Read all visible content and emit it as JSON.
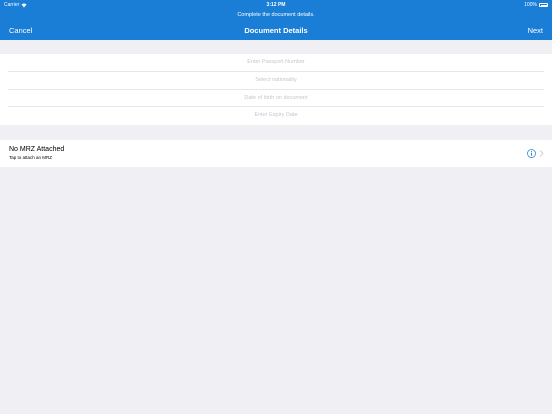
{
  "status_bar": {
    "carrier": "Carrier",
    "time": "3:12 PM",
    "battery_percent": "100%",
    "battery_level": 1.0
  },
  "header": {
    "prompt": "Complete the document details.",
    "cancel_label": "Cancel",
    "title": "Document Details",
    "next_label": "Next"
  },
  "form": {
    "passport_number_placeholder": "Enter Passport Number",
    "nationality_placeholder": "Select nationality",
    "dob_placeholder": "Date of birth on document",
    "expiry_placeholder": "Enter Expiry Date"
  },
  "mrz": {
    "title": "No MRZ Attached",
    "subtitle": "Tap to attach an MRZ"
  },
  "colors": {
    "nav_background": "#1a7ed6",
    "page_background": "#efeff4",
    "info_icon": "#1a7ed6"
  }
}
